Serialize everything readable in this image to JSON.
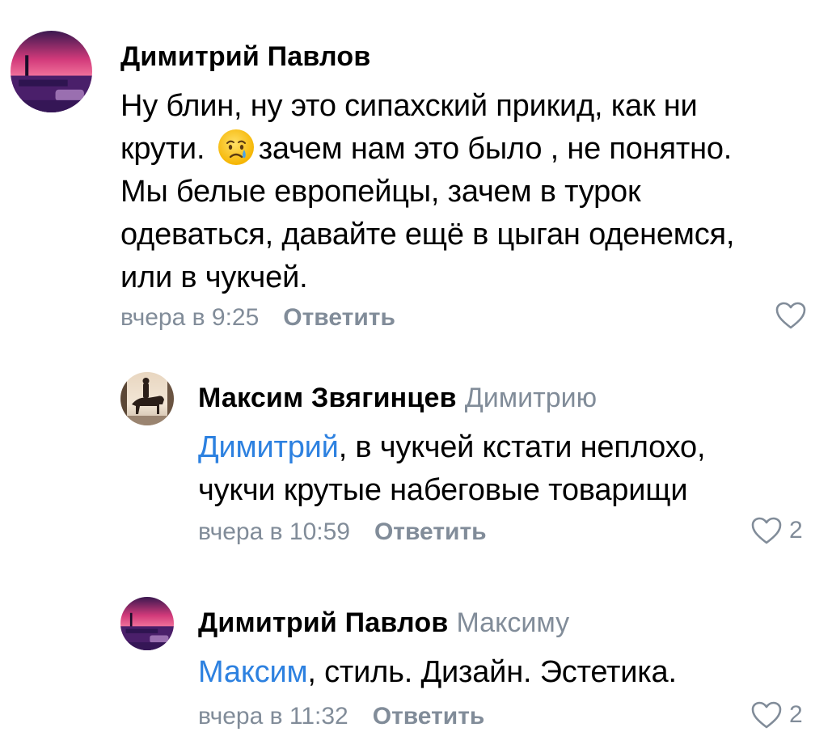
{
  "comments": [
    {
      "author": "Димитрий Павлов",
      "reply_to": "",
      "mention": "",
      "text_line1_before_emoji": "Ну блин, ну это сипахский прикид, как ни",
      "text_line2_before_emoji": "крути. ",
      "emoji": "crying-face",
      "text_line2_after_emoji": "зачем нам это было , не понятно.",
      "text_line3": "Мы белые европейцы, зачем в турок",
      "text_line4": "одеваться, давайте ещё в цыган оденемся,",
      "text_line5": "или в чукчей.",
      "time": "вчера в 9:25",
      "reply_label": "Ответить",
      "likes": ""
    },
    {
      "author": "Максим Звягинцев",
      "reply_to": "Димитрию",
      "mention": "Димитрий",
      "text_line1": ", в чукчей кстати неплохо,",
      "text_line2": "чукчи крутые набеговые товарищи",
      "time": "вчера в 10:59",
      "reply_label": "Ответить",
      "likes": "2"
    },
    {
      "author": "Димитрий Павлов",
      "reply_to": "Максиму",
      "mention": "Максим",
      "text_line1": ", стиль. Дизайн. Эстетика.",
      "time": "вчера в 11:32",
      "reply_label": "Ответить",
      "likes": "2"
    }
  ],
  "colors": {
    "meta_gray": "#818c99",
    "mention_blue": "#2d81e0",
    "text_black": "#000000"
  },
  "icons": {
    "like": "heart-outline-icon",
    "emoji": "crying-face-emoji"
  }
}
